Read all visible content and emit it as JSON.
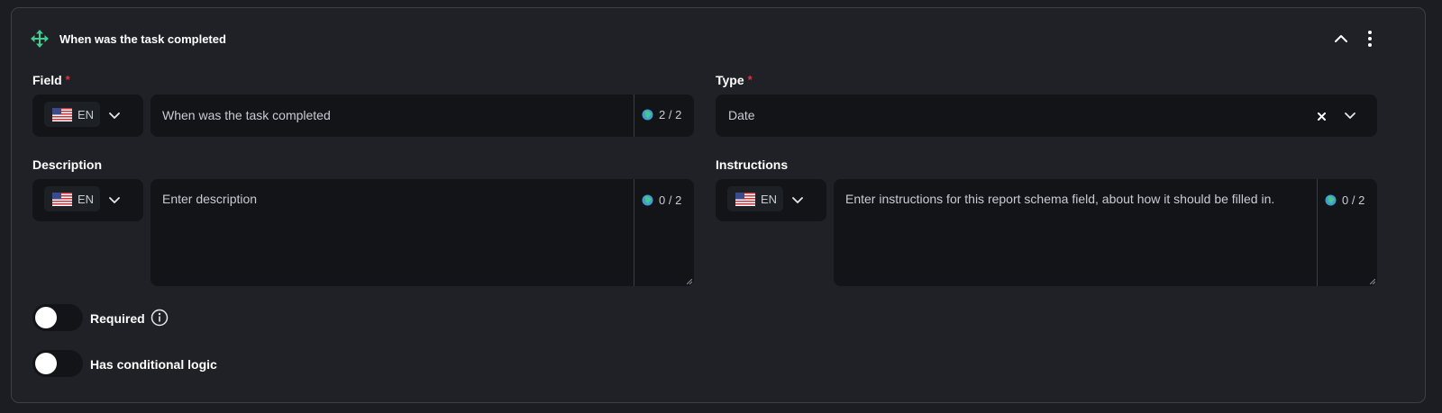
{
  "header": {
    "title": "When was the task completed",
    "icons": [
      "move-icon",
      "chevron-up-icon",
      "more-vertical-icon"
    ]
  },
  "field": {
    "label": "Field",
    "required_mark": "*",
    "lang": "EN",
    "value": "When was the task completed",
    "counter": "2 / 2"
  },
  "type": {
    "label": "Type",
    "required_mark": "*",
    "value": "Date"
  },
  "description": {
    "label": "Description",
    "lang": "EN",
    "placeholder": "Enter description",
    "counter": "0 / 2"
  },
  "instructions": {
    "label": "Instructions",
    "lang": "EN",
    "placeholder": "Enter instructions for this report schema field, about how it should be filled in.",
    "counter": "0 / 2"
  },
  "toggles": {
    "required": {
      "label": "Required",
      "on": false
    },
    "conditional": {
      "label": "Has conditional logic",
      "on": false
    }
  },
  "colors": {
    "accent_green": "#3ecf8e",
    "required_red": "#e0323c",
    "background": "#202127",
    "input_bg": "#121417"
  }
}
